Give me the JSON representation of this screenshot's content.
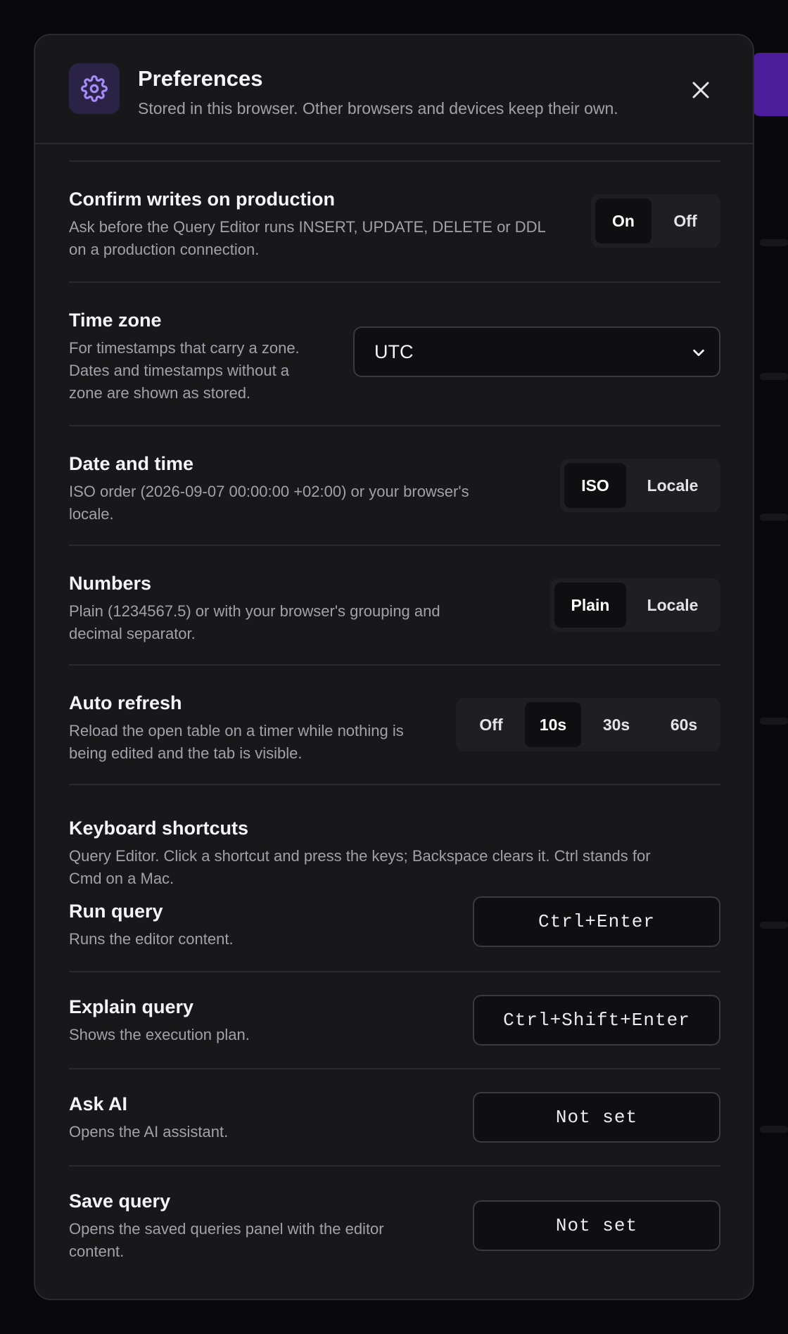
{
  "colors": {
    "accent": "#8b5cf6",
    "surface": "#18181b",
    "active_segment": "#0f0f11"
  },
  "header": {
    "icon": "gear-icon",
    "title": "Preferences",
    "subtitle": "Stored in this browser. Other browsers and devices keep their own."
  },
  "settings": {
    "confirm_writes": {
      "label": "Confirm writes on production",
      "description_line1": "Ask before the Query Editor runs INSERT, UPDATE, DELETE or DDL",
      "description_line2": "on a production connection.",
      "options": [
        "On",
        "Off"
      ],
      "selected": "On"
    },
    "time_zone": {
      "label": "Time zone",
      "description_line1": "For timestamps that carry a zone.",
      "description_line2": "Dates and timestamps without a",
      "description_line3": "zone are shown as stored.",
      "value": "UTC"
    },
    "date_time": {
      "label": "Date and time",
      "description_line1": "ISO order (2026-09-07 00:00:00 +02:00) or your browser's",
      "description_line2": "locale.",
      "options": [
        "ISO",
        "Locale"
      ],
      "selected": "ISO"
    },
    "numbers": {
      "label": "Numbers",
      "description_line1": "Plain (1234567.5) or with your browser's grouping and",
      "description_line2": "decimal separator.",
      "options": [
        "Plain",
        "Locale"
      ],
      "selected": "Plain"
    },
    "auto_refresh": {
      "label": "Auto refresh",
      "description_line1": "Reload the open table on a timer while nothing is",
      "description_line2": "being edited and the tab is visible.",
      "options": [
        "Off",
        "10s",
        "30s",
        "60s"
      ],
      "selected": "10s"
    }
  },
  "shortcuts": {
    "label": "Keyboard shortcuts",
    "description_line1": "Query Editor. Click a shortcut and press the keys; Backspace clears it. Ctrl stands for",
    "description_line2": "Cmd on a Mac.",
    "items": [
      {
        "label": "Run query",
        "description": "Runs the editor content.",
        "keys": "Ctrl+Enter"
      },
      {
        "label": "Explain query",
        "description": "Shows the execution plan.",
        "keys": "Ctrl+Shift+Enter"
      },
      {
        "label": "Ask AI",
        "description": "Opens the AI assistant.",
        "keys": "Not set"
      },
      {
        "label": "Save query",
        "description_line1": "Opens the saved queries panel with the editor",
        "description_line2": "content.",
        "keys": "Not set"
      }
    ]
  }
}
